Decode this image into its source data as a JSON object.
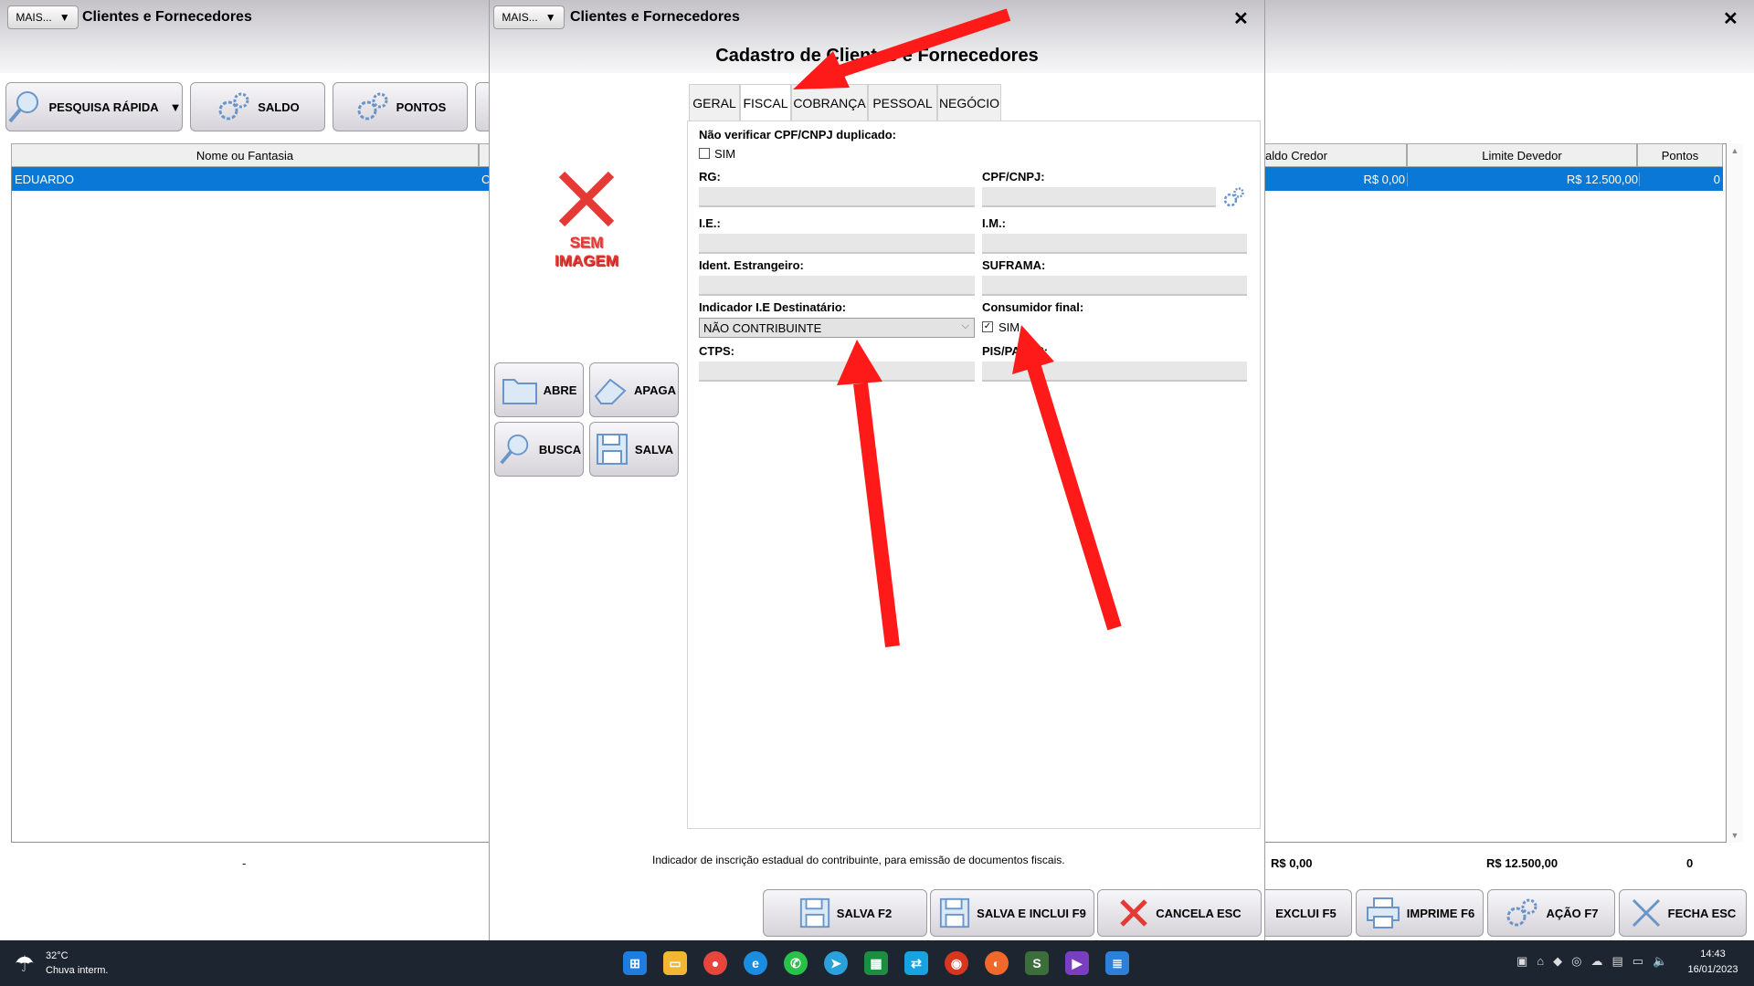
{
  "bg_window": {
    "more_label": "MAIS...",
    "title": "Clientes e Fornecedores",
    "toolbar": {
      "quick_search": "PESQUISA RÁPIDA",
      "balance": "SALDO",
      "points": "PONTOS"
    },
    "table": {
      "col_name": "Nome ou Fantasia",
      "col_credit": "aldo Credor",
      "col_debit": "Limite Devedor",
      "col_points": "Pontos",
      "row_name": "EDUARDO",
      "row_c": "C",
      "row_credit": "R$ 0,00",
      "row_debit": "R$ 12.500,00",
      "row_points": "0"
    },
    "footer": {
      "dash": "-",
      "credit_total": "R$ 0,00",
      "debit_total": "R$ 12.500,00",
      "points_total": "0"
    },
    "buttons": {
      "delete": "EXCLUI F5",
      "print": "IMPRIME F6",
      "action": "AÇÃO F7",
      "close": "FECHA ESC"
    }
  },
  "dialog": {
    "more_label": "MAIS...",
    "title": "Clientes e Fornecedores",
    "heading": "Cadastro de Clientes e Fornecedores",
    "tabs": [
      "GERAL",
      "FISCAL",
      "COBRANÇA",
      "PESSOAL",
      "NEGÓCIO"
    ],
    "no_image_line1": "SEM",
    "no_image_line2": "IMAGEM",
    "image_buttons": {
      "open": "ABRE",
      "erase": "APAGA",
      "search": "BUSCA",
      "save": "SALVA"
    },
    "form": {
      "dup_label": "Não verificar CPF/CNPJ duplicado:",
      "dup_sim": "SIM",
      "rg": "RG:",
      "cpf": "CPF/CNPJ:",
      "ie": "I.E.:",
      "im": "I.M.:",
      "foreign_id": "Ident. Estrangeiro:",
      "suframa": "SUFRAMA:",
      "ie_indicator": "Indicador I.E Destinatário:",
      "ie_indicator_value": "NÃO CONTRIBUINTE",
      "final_consumer": "Consumidor final:",
      "final_consumer_sim": "SIM",
      "ctps": "CTPS:",
      "pis": "PIS/PASEP:"
    },
    "hint": "Indicador de inscrição estadual do contribuinte, para emissão de documentos fiscais.",
    "buttons": {
      "save": "SALVA F2",
      "save_new": "SALVA E INCLUI F9",
      "cancel": "CANCELA ESC"
    }
  },
  "taskbar": {
    "temp": "32°C",
    "weather": "Chuva interm.",
    "time": "14:43",
    "date": "16/01/2023"
  },
  "colors": {
    "selection": "#0a78d7",
    "arrow": "#ff1a1a",
    "no_image": "#e53935"
  }
}
